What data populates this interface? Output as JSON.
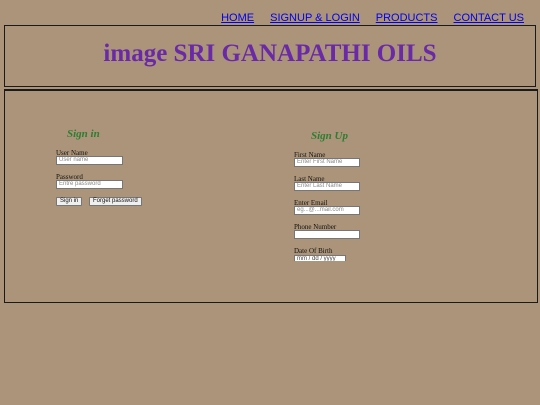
{
  "nav": {
    "home": "HOME",
    "signup_login": "SIGNUP & LOGIN",
    "products": "PRODUCTS",
    "contact": "CONTACT US"
  },
  "header": {
    "title": "image SRI GANAPATHI OILS"
  },
  "signin": {
    "title": "Sign in",
    "username_label": "User Name",
    "username_placeholder": "User name",
    "password_label": "Password",
    "password_placeholder": "Entre password",
    "signin_button": "Sign in",
    "forgot_button": "Forget password"
  },
  "signup": {
    "title": "Sign Up",
    "first_name_label": "First Name",
    "first_name_placeholder": "Enter First Name",
    "last_name_label": "Last Name",
    "last_name_placeholder": "Enter Last Name",
    "email_label": "Enter Email",
    "email_placeholder": "eg...@...mail.com",
    "phone_label": "Phone Number",
    "phone_placeholder": "",
    "dob_label": "Date Of Birth",
    "dob_placeholder": "mm / dd / yyyy"
  },
  "colors": {
    "background": "#ab9479",
    "title": "#6a2aa8",
    "form_title": "#2e7d32",
    "link": "#0000ee"
  }
}
